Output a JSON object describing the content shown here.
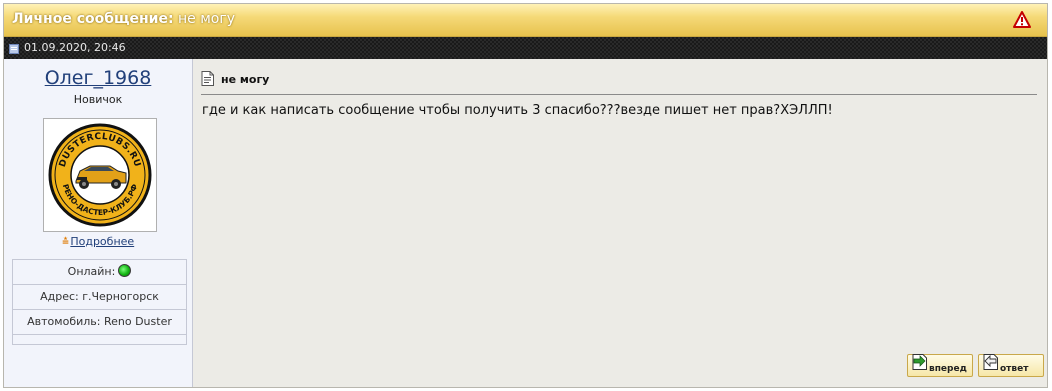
{
  "header": {
    "title_label": "Личное сообщение:",
    "title_subject": "не могу",
    "report_icon": "warning-triangle-icon"
  },
  "datebar": {
    "datetime": "01.09.2020, 20:46",
    "icon": "post-icon"
  },
  "sidebar": {
    "username": "Олег_1968",
    "rank": "Новичок",
    "avatar_text_top": "DUSTERCLUBS.RU",
    "avatar_text_bottom": "РЕНО-ДАСТЕР-КЛУБ.РФ",
    "more_label": "Подробнее",
    "info": {
      "online_label": "Онлайн:",
      "address": "Адрес: г.Черногорск",
      "car": "Автомобиль: Reno Duster"
    }
  },
  "post": {
    "subject": "не могу",
    "body": "где и как написать сообщение чтобы получить 3 спасибо???везде пишет нет прав?ХЭЛЛП!"
  },
  "actions": {
    "forward_label": "вперед",
    "reply_label": "ответ"
  },
  "colors": {
    "header_gold": "#e7c24d",
    "link_blue": "#22407a",
    "online_green": "#13b513",
    "avatar_yellow": "#f1b21a"
  }
}
